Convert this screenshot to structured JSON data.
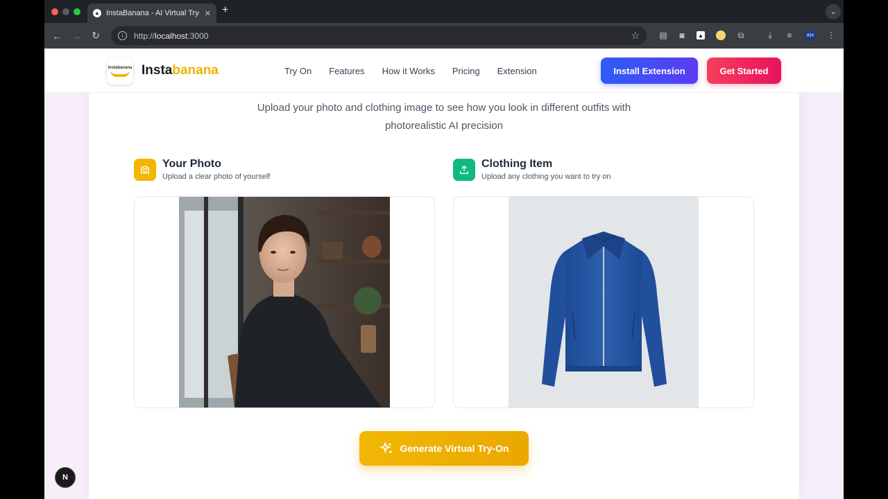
{
  "browser": {
    "tab_title": "InstaBanana - AI Virtual Try-O",
    "url_prefix": "http://",
    "url_host": "localhost",
    "url_port": ":3000",
    "profile_initials": "KH"
  },
  "header": {
    "logo_text": "instabanana",
    "brand_part1": "Insta",
    "brand_part2": "banana",
    "nav": [
      "Try On",
      "Features",
      "How it Works",
      "Pricing",
      "Extension"
    ],
    "install_label": "Install Extension",
    "start_label": "Get Started"
  },
  "hero": {
    "subtitle_line1": "Upload your photo and clothing image to see how you look in different outfits with",
    "subtitle_line2": "photorealistic AI precision"
  },
  "photo_section": {
    "title": "Your Photo",
    "subtitle": "Upload a clear photo of yourself",
    "icon": "camera-icon"
  },
  "clothing_section": {
    "title": "Clothing Item",
    "subtitle": "Upload any clothing you want to try on",
    "icon": "upload-icon"
  },
  "generate_label": "Generate Virtual Try-On",
  "dev_badge": "N",
  "colors": {
    "brand_yellow": "#f0b400",
    "install_blue": "#2f5cf6",
    "start_pink": "#f43f5e",
    "upload_green": "#10b981"
  }
}
